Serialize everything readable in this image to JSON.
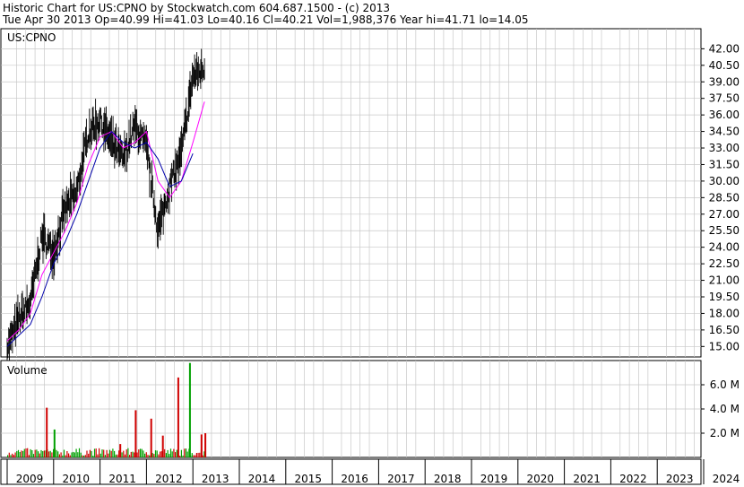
{
  "header": {
    "line1": "Historic Chart for US:CPNO by Stockwatch.com 604.687.1500 - (c) 2013",
    "line2": "Tue Apr 30 2013   Op=40.99  Hi=41.03   Lo=40.16   Cl=40.21   Vol=1,988,376   Year hi=41.71   lo=14.05"
  },
  "colors": {
    "background": "#ffffff",
    "grid": "#c8c8c8",
    "frame": "#000000",
    "price_bar": "#000000",
    "ma_short": "#ff00ff",
    "ma_long": "#0000aa",
    "volume_up": "#00a000",
    "volume_down": "#d00000"
  },
  "chart_data": [
    {
      "type": "line",
      "title": "US:CPNO",
      "ylim": [
        14.05,
        42.6
      ],
      "y_ticks": [
        "42.00",
        "40.50",
        "39.00",
        "37.50",
        "36.00",
        "34.50",
        "33.00",
        "31.50",
        "30.00",
        "28.50",
        "27.00",
        "25.50",
        "24.00",
        "22.50",
        "21.00",
        "19.50",
        "18.00",
        "16.50",
        "15.00"
      ],
      "x_tick_labels": [
        "2009",
        "2010",
        "2011",
        "2012",
        "2013",
        "2014",
        "2015",
        "2016",
        "2017",
        "2018",
        "2019",
        "2020",
        "2021",
        "2022",
        "2023",
        "2024"
      ],
      "series": [
        {
          "x": [
            "2009-01",
            "2009-04",
            "2009-07",
            "2009-10",
            "2010-01",
            "2010-04",
            "2010-07",
            "2010-10",
            "2011-01",
            "2011-04",
            "2011-07",
            "2011-10",
            "2012-01",
            "2012-04",
            "2012-07",
            "2012-10",
            "2013-01",
            "2013-04"
          ],
          "values": [
            14.8,
            17.5,
            19.0,
            25.0,
            23.5,
            27.5,
            29.0,
            34.5,
            35.5,
            33.5,
            32.0,
            35.0,
            33.0,
            25.5,
            29.5,
            32.5,
            39.5,
            40.21
          ]
        },
        {
          "x": [
            "2009-01",
            "2009-04",
            "2009-07",
            "2009-10",
            "2010-01",
            "2010-04",
            "2010-07",
            "2010-10",
            "2011-01",
            "2011-04",
            "2011-07",
            "2011-10",
            "2012-01",
            "2012-04",
            "2012-07",
            "2012-10",
            "2013-01",
            "2013-04"
          ],
          "values": [
            15.5,
            16.5,
            18.0,
            21.5,
            23.5,
            25.5,
            28.0,
            31.5,
            34.0,
            34.5,
            33.0,
            33.5,
            34.5,
            30.0,
            28.5,
            30.0,
            33.5,
            37.2
          ]
        },
        {
          "x": [
            "2009-01",
            "2009-04",
            "2009-07",
            "2009-10",
            "2010-01",
            "2010-04",
            "2010-07",
            "2010-10",
            "2011-01",
            "2011-04",
            "2011-07",
            "2011-10",
            "2012-01",
            "2012-04",
            "2012-07",
            "2012-10",
            "2013-01"
          ],
          "values": [
            15.0,
            16.0,
            17.0,
            19.5,
            22.5,
            24.5,
            27.0,
            30.0,
            33.0,
            34.5,
            33.5,
            33.0,
            33.5,
            32.0,
            29.5,
            30.0,
            32.5
          ]
        }
      ]
    },
    {
      "type": "bar",
      "title": "Volume",
      "ylim": [
        0,
        8.0
      ],
      "y_ticks": [
        "6.0 M",
        "4.0 M",
        "2.0 M"
      ],
      "spikes": [
        {
          "x": "2009-11",
          "value": 4.1,
          "dir": "down"
        },
        {
          "x": "2010-01",
          "value": 2.3,
          "dir": "up"
        },
        {
          "x": "2011-06",
          "value": 1.1,
          "dir": "down"
        },
        {
          "x": "2011-10",
          "value": 3.9,
          "dir": "down"
        },
        {
          "x": "2012-02",
          "value": 3.2,
          "dir": "down"
        },
        {
          "x": "2012-05",
          "value": 1.8,
          "dir": "down"
        },
        {
          "x": "2012-09",
          "value": 6.6,
          "dir": "down"
        },
        {
          "x": "2012-12",
          "value": 7.8,
          "dir": "up"
        },
        {
          "x": "2013-03",
          "value": 1.9,
          "dir": "down"
        },
        {
          "x": "2013-04",
          "value": 2.0,
          "dir": "down"
        }
      ],
      "base_level": 0.45
    }
  ]
}
